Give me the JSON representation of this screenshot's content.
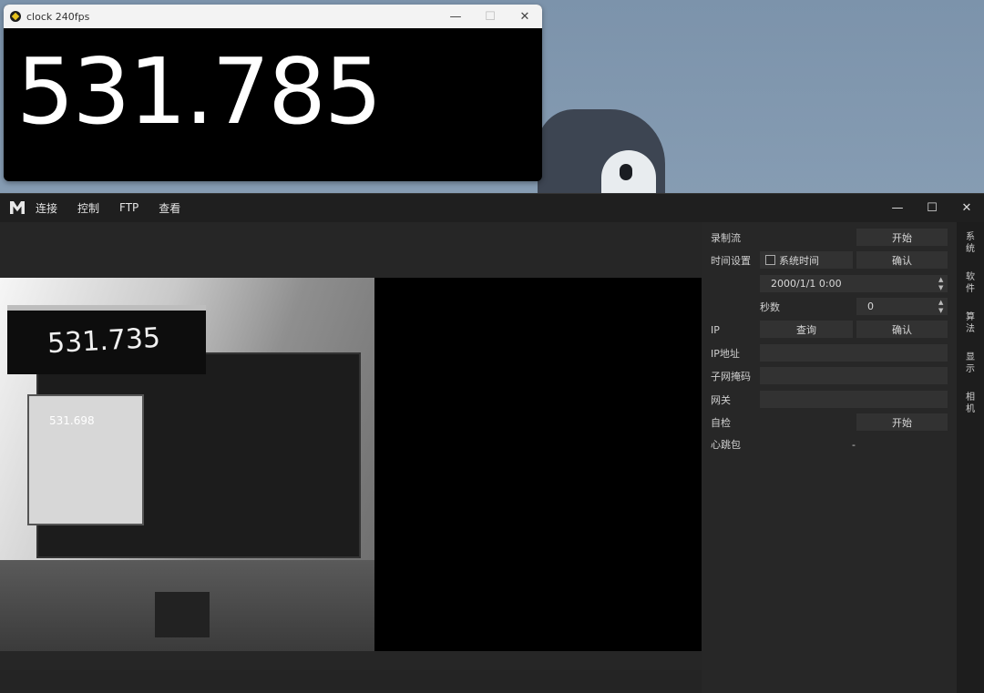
{
  "clock_window": {
    "title": "clock 240fps",
    "time_display": "531.785",
    "controls": {
      "minimize": "—",
      "maximize": "☐",
      "close": "✕"
    }
  },
  "app": {
    "menu": [
      "连接",
      "控制",
      "FTP",
      "查看"
    ],
    "controls": {
      "minimize": "—",
      "maximize": "☐",
      "close": "✕"
    },
    "camera_preview": {
      "captured_clock": "531.735",
      "captured_inner_clock": "531.698"
    },
    "panel": {
      "record_label": "录制流",
      "record_button": "开始",
      "time_setting_label": "时间设置",
      "system_time_label": "系统时间",
      "system_time_checked": false,
      "time_confirm_button": "确认",
      "datetime_value": "2000/1/1 0:00",
      "seconds_label": "秒数",
      "seconds_value": "0",
      "ip_label": "IP",
      "ip_query_button": "查询",
      "ip_confirm_button": "确认",
      "ip_address_label": "IP地址",
      "ip_address_value": "",
      "subnet_label": "子网掩码",
      "subnet_value": "",
      "gateway_label": "网关",
      "gateway_value": "",
      "self_test_label": "自检",
      "self_test_button": "开始",
      "heartbeat_label": "心跳包",
      "heartbeat_value": "-"
    },
    "side_tabs": [
      "系统",
      "软件",
      "算法",
      "显示",
      "相机"
    ]
  }
}
